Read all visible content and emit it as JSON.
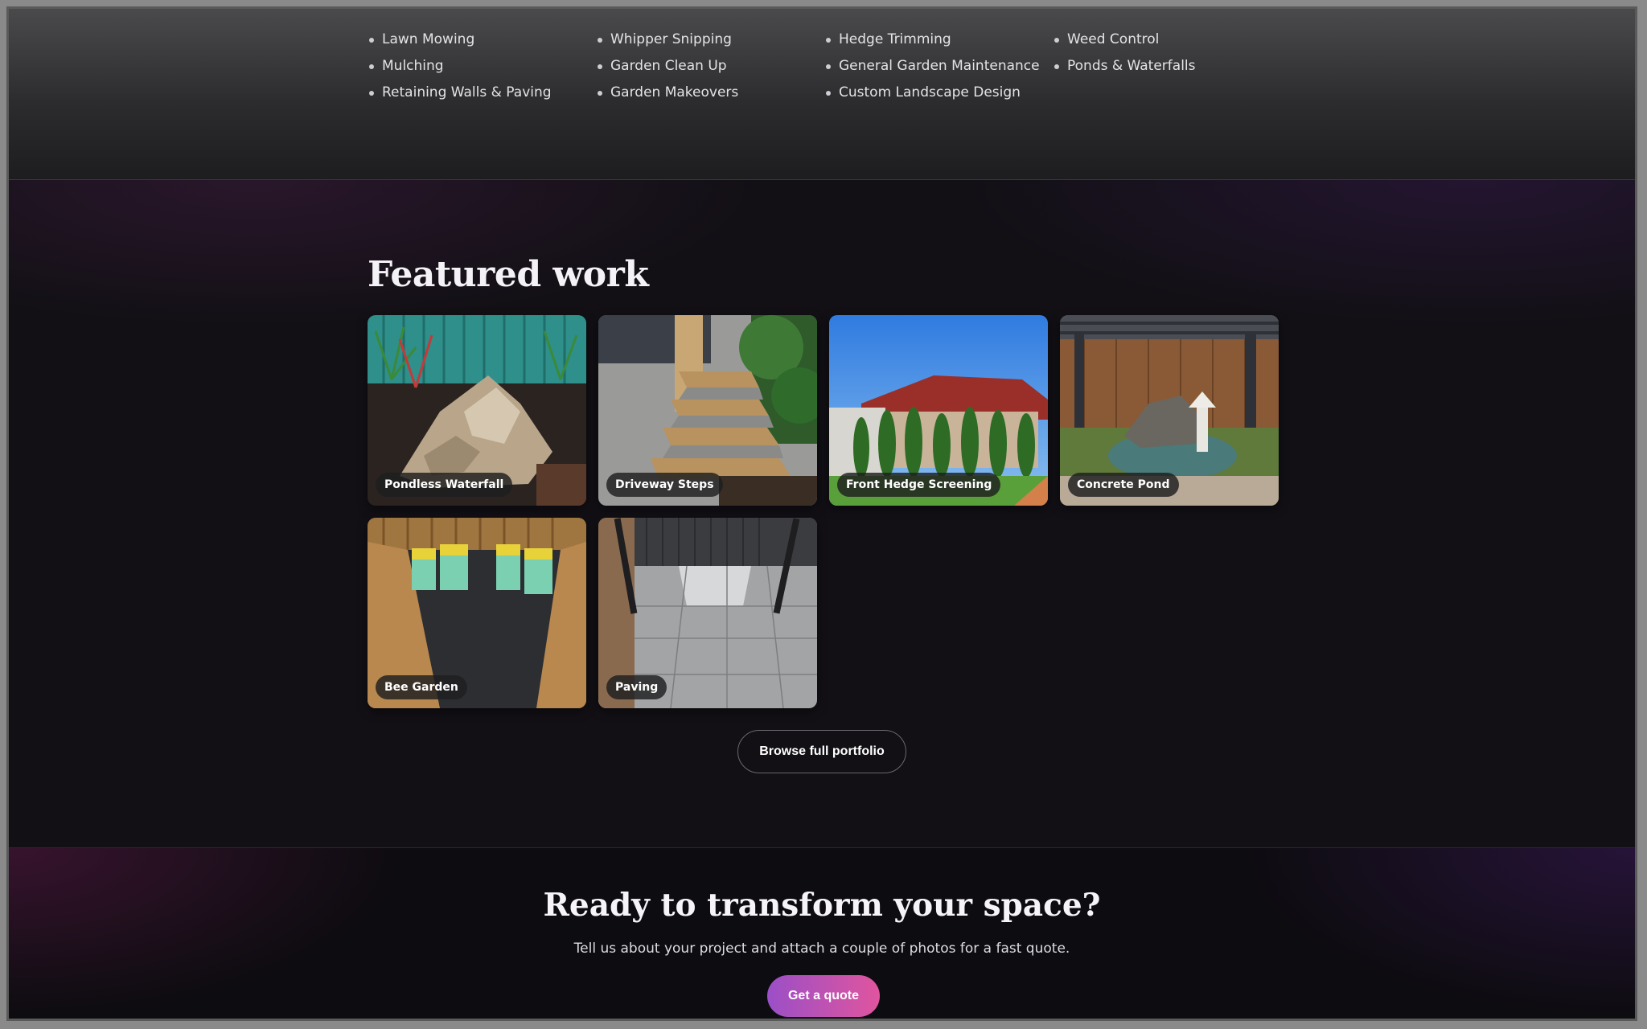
{
  "services": {
    "items": [
      "Lawn Mowing",
      "Whipper Snipping",
      "Hedge Trimming",
      "Weed Control",
      "Mulching",
      "Garden Clean Up",
      "General Garden Maintenance",
      "Ponds & Waterfalls",
      "Retaining Walls & Paving",
      "Garden Makeovers",
      "Custom Landscape Design"
    ]
  },
  "featured": {
    "title": "Featured work",
    "projects": [
      {
        "label": "Pondless Waterfall"
      },
      {
        "label": "Driveway Steps"
      },
      {
        "label": "Front Hedge Screening"
      },
      {
        "label": "Concrete Pond"
      },
      {
        "label": "Bee Garden"
      },
      {
        "label": "Paving"
      }
    ],
    "browse_label": "Browse full portfolio"
  },
  "cta": {
    "title": "Ready to transform your space?",
    "subtitle": "Tell us about your project and attach a couple of photos for a fast quote.",
    "button_label": "Get a quote"
  },
  "colors": {
    "accent_start": "#9b4fc7",
    "accent_end": "#e0559e"
  }
}
